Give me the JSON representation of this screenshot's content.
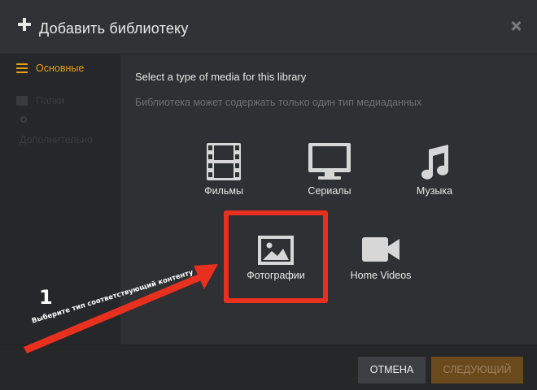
{
  "dialog": {
    "title": "Добавить библиотеку"
  },
  "sidebar": {
    "items": [
      {
        "label": "Основные",
        "icon": "lines-icon",
        "active": true
      },
      {
        "label": "Папки",
        "icon": "folder-icon",
        "active": false
      },
      {
        "label": "Дополнительно",
        "icon": "gear-icon",
        "active": false
      }
    ]
  },
  "main": {
    "heading": "Select a type of media for this library",
    "subheading": "Библиотека может содержать только один тип медиаданных",
    "media_types": [
      {
        "label": "Фильмы",
        "icon": "film-strip-icon"
      },
      {
        "label": "Сериалы",
        "icon": "tv-icon"
      },
      {
        "label": "Музыка",
        "icon": "music-note-icon"
      },
      {
        "label": "Фотографии",
        "icon": "photo-icon"
      },
      {
        "label": "Home Videos",
        "icon": "video-camera-icon"
      }
    ]
  },
  "footer": {
    "cancel_label": "ОТМЕНА",
    "next_label": "СЛЕДУЮЩИЙ"
  },
  "annotation": {
    "step_number": "1",
    "text": "Выберите тип соответствующий контенту"
  },
  "colors": {
    "accent": "#e5a00d",
    "highlight": "#e8301f",
    "background": "#2f3033",
    "sidebar": "#26272a"
  }
}
